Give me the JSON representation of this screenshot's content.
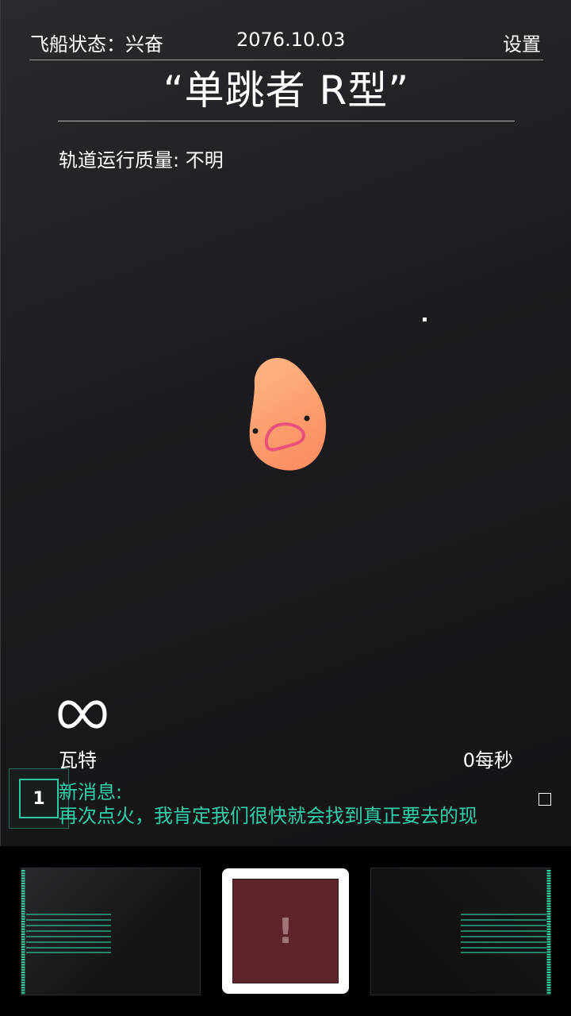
{
  "header": {
    "status_label": "飞船状态：兴奋",
    "date": "2076.10.03",
    "settings_label": "设置"
  },
  "ship": {
    "name": "“单跳者 R型”",
    "orbit_quality": "轨道运行质量: 不明"
  },
  "power": {
    "value_symbol": "∞",
    "unit": "瓦特",
    "rate": "0每秒"
  },
  "message": {
    "count": "1",
    "title": "新消息:",
    "body": "再次点火，我肯定我们很快就会找到真正要去的现"
  },
  "alert": {
    "icon": "!"
  },
  "colors": {
    "accent": "#2fd0a8",
    "alert_bg": "#5c242b",
    "creature_orange": "#fda070",
    "creature_mouth": "#e94f7b"
  }
}
